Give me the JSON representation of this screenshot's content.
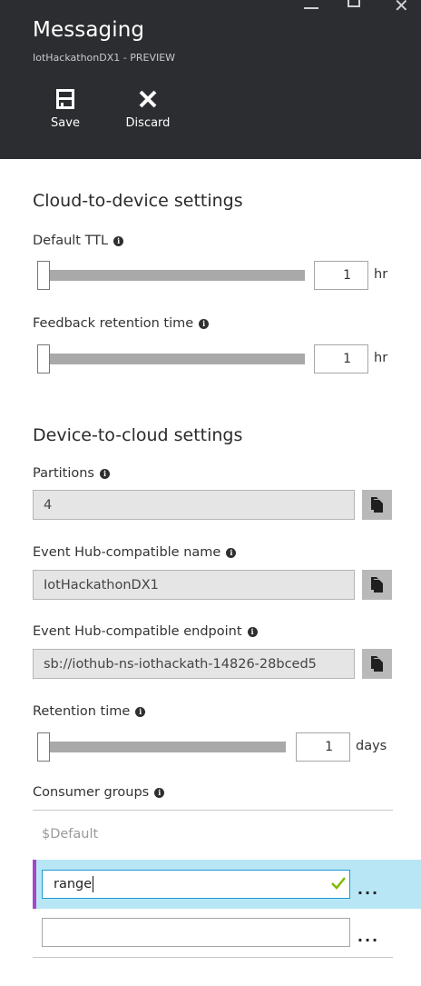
{
  "header": {
    "title": "Messaging",
    "subtitle": "IotHackathonDX1 - PREVIEW",
    "save_label": "Save",
    "discard_label": "Discard",
    "background": "#2b2d30"
  },
  "cloud_to_device": {
    "title": "Cloud-to-device settings",
    "default_ttl": {
      "label": "Default TTL",
      "value": "1",
      "unit": "hr",
      "level": 0
    },
    "feedback_retention": {
      "label": "Feedback retention time",
      "value": "1",
      "unit": "hr",
      "level": 0
    }
  },
  "device_to_cloud": {
    "title": "Device-to-cloud settings",
    "partitions": {
      "label": "Partitions",
      "value": "4"
    },
    "event_hub_name": {
      "label": "Event Hub-compatible name",
      "value": "IotHackathonDX1"
    },
    "event_hub_endpoint": {
      "label": "Event Hub-compatible endpoint",
      "value": "sb://iothub-ns-iothackath-14826-28bced5"
    },
    "retention_time": {
      "label": "Retention time",
      "value": "1",
      "unit": "days",
      "level": 0
    }
  },
  "consumer_groups": {
    "label": "Consumer groups",
    "default_group": "$Default",
    "new_group_value": "range",
    "more_label": "...",
    "active_color": "#b9e6f5",
    "marker_color": "#a447c8",
    "focus_color": "#1a9bd7",
    "valid_color": "#7fba00"
  },
  "icons": {
    "save": "save-icon",
    "discard": "close-icon",
    "info": "info-icon",
    "copy": "copy-icon",
    "valid": "check-icon"
  }
}
